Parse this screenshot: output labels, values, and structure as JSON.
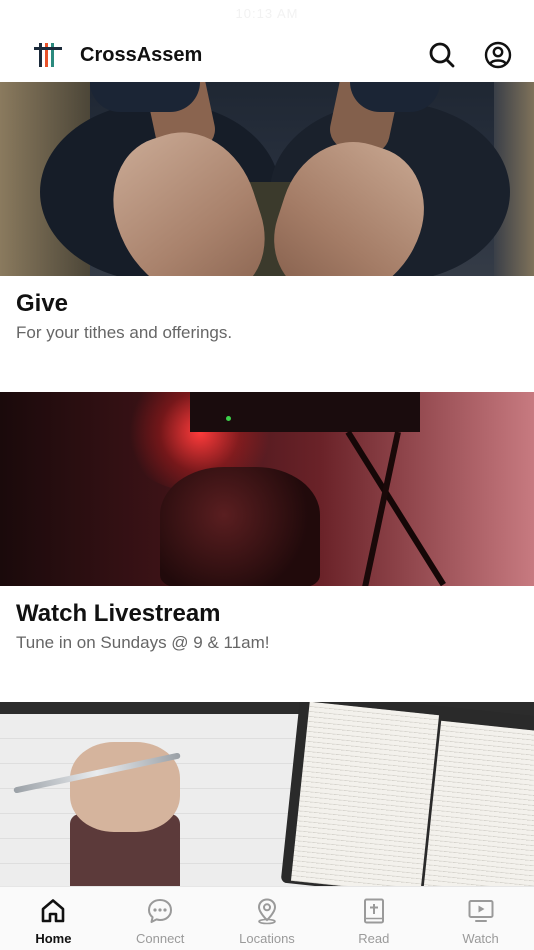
{
  "status_bar": {
    "time": "10:13 AM"
  },
  "header": {
    "app_name": "CrossAssem",
    "logo_colors": [
      "#1b2a3a",
      "#e8522a",
      "#2b8a7e"
    ],
    "search_icon": "search-icon",
    "account_icon": "user-circle-icon"
  },
  "cards": [
    {
      "title": "Give",
      "subtitle": "For your tithes and offerings.",
      "image": "open-hands-photo"
    },
    {
      "title": "Watch Livestream",
      "subtitle": "Tune in on Sundays @ 9 & 11am!",
      "image": "camera-red-light-photo"
    },
    {
      "title": "",
      "subtitle": "",
      "image": "bible-and-notebook-photo"
    }
  ],
  "tabbar": {
    "active_index": 0,
    "items": [
      {
        "label": "Home",
        "icon": "home-icon"
      },
      {
        "label": "Connect",
        "icon": "chat-bubble-icon"
      },
      {
        "label": "Locations",
        "icon": "map-pin-icon"
      },
      {
        "label": "Read",
        "icon": "bible-icon"
      },
      {
        "label": "Watch",
        "icon": "tv-play-icon"
      }
    ]
  }
}
